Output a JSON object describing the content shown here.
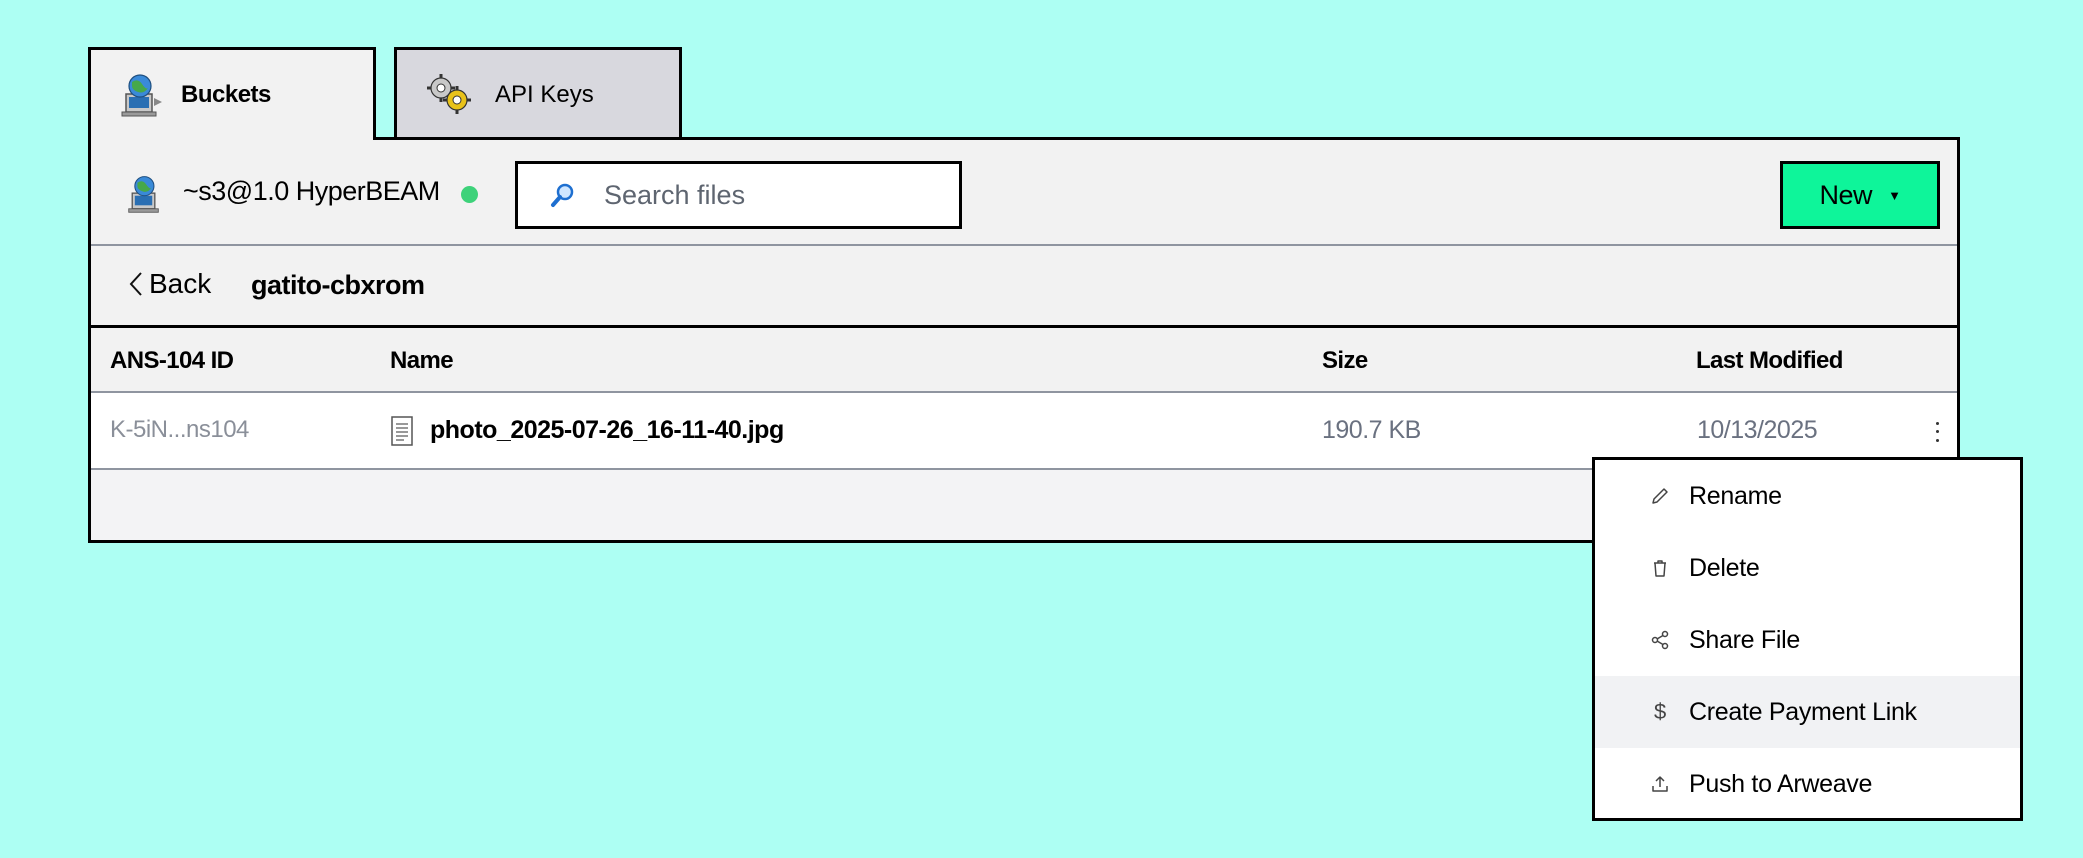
{
  "tabs": [
    {
      "label": "Buckets",
      "icon": "globe-computer-icon",
      "active": true
    },
    {
      "label": "API Keys",
      "icon": "gears-icon",
      "active": false
    }
  ],
  "toolbar": {
    "server_label": "~s3@1.0 HyperBEAM",
    "status_color": "#3ed27a",
    "search_placeholder": "Search files",
    "new_label": "New",
    "new_color": "#0ef59a"
  },
  "path": {
    "back_label": "Back",
    "bucket_name": "gatito-cbxrom"
  },
  "table": {
    "columns": [
      "ANS-104 ID",
      "Name",
      "Size",
      "Last Modified"
    ],
    "rows": [
      {
        "id": "K-5iN...ns104",
        "name": "photo_2025-07-26_16-11-40.jpg",
        "size": "190.7 KB",
        "modified": "10/13/2025"
      }
    ]
  },
  "context_menu": {
    "items": [
      {
        "label": "Rename",
        "icon": "pencil-icon"
      },
      {
        "label": "Delete",
        "icon": "trash-icon"
      },
      {
        "label": "Share File",
        "icon": "share-icon"
      },
      {
        "label": "Create Payment Link",
        "icon": "dollar-icon"
      },
      {
        "label": "Push to Arweave",
        "icon": "upload-icon"
      }
    ]
  },
  "colors": {
    "background": "#adfff3",
    "accent": "#0ef59a"
  }
}
